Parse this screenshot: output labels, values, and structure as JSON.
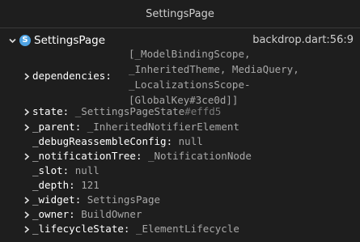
{
  "window": {
    "title": "SettingsPage"
  },
  "root": {
    "icon_letter": "S",
    "label": "SettingsPage",
    "source": "backdrop.dart:56:9"
  },
  "dependencies": {
    "key": "dependencies",
    "lines": [
      "[_ModelBindingScope,",
      "_InheritedTheme, MediaQuery,",
      "_LocalizationsScope-",
      "[GlobalKey#3ce0d]]"
    ]
  },
  "properties": [
    {
      "key": "state",
      "value": "_SettingsPageState",
      "hash": "#effd5",
      "expandable": true
    },
    {
      "key": "_parent",
      "value": "_InheritedNotifierElement",
      "expandable": true
    },
    {
      "key": "_debugReassembleConfig",
      "value": "null",
      "expandable": false
    },
    {
      "key": "_notificationTree",
      "value": "_NotificationNode",
      "expandable": true
    },
    {
      "key": "_slot",
      "value": "null",
      "expandable": false
    },
    {
      "key": "_depth",
      "value": "121",
      "expandable": false
    },
    {
      "key": "_widget",
      "value": "SettingsPage",
      "expandable": true
    },
    {
      "key": "_owner",
      "value": "BuildOwner",
      "expandable": true
    },
    {
      "key": "_lifecycleState",
      "value": "_ElementLifecycle",
      "expandable": true
    }
  ],
  "separator": ":"
}
